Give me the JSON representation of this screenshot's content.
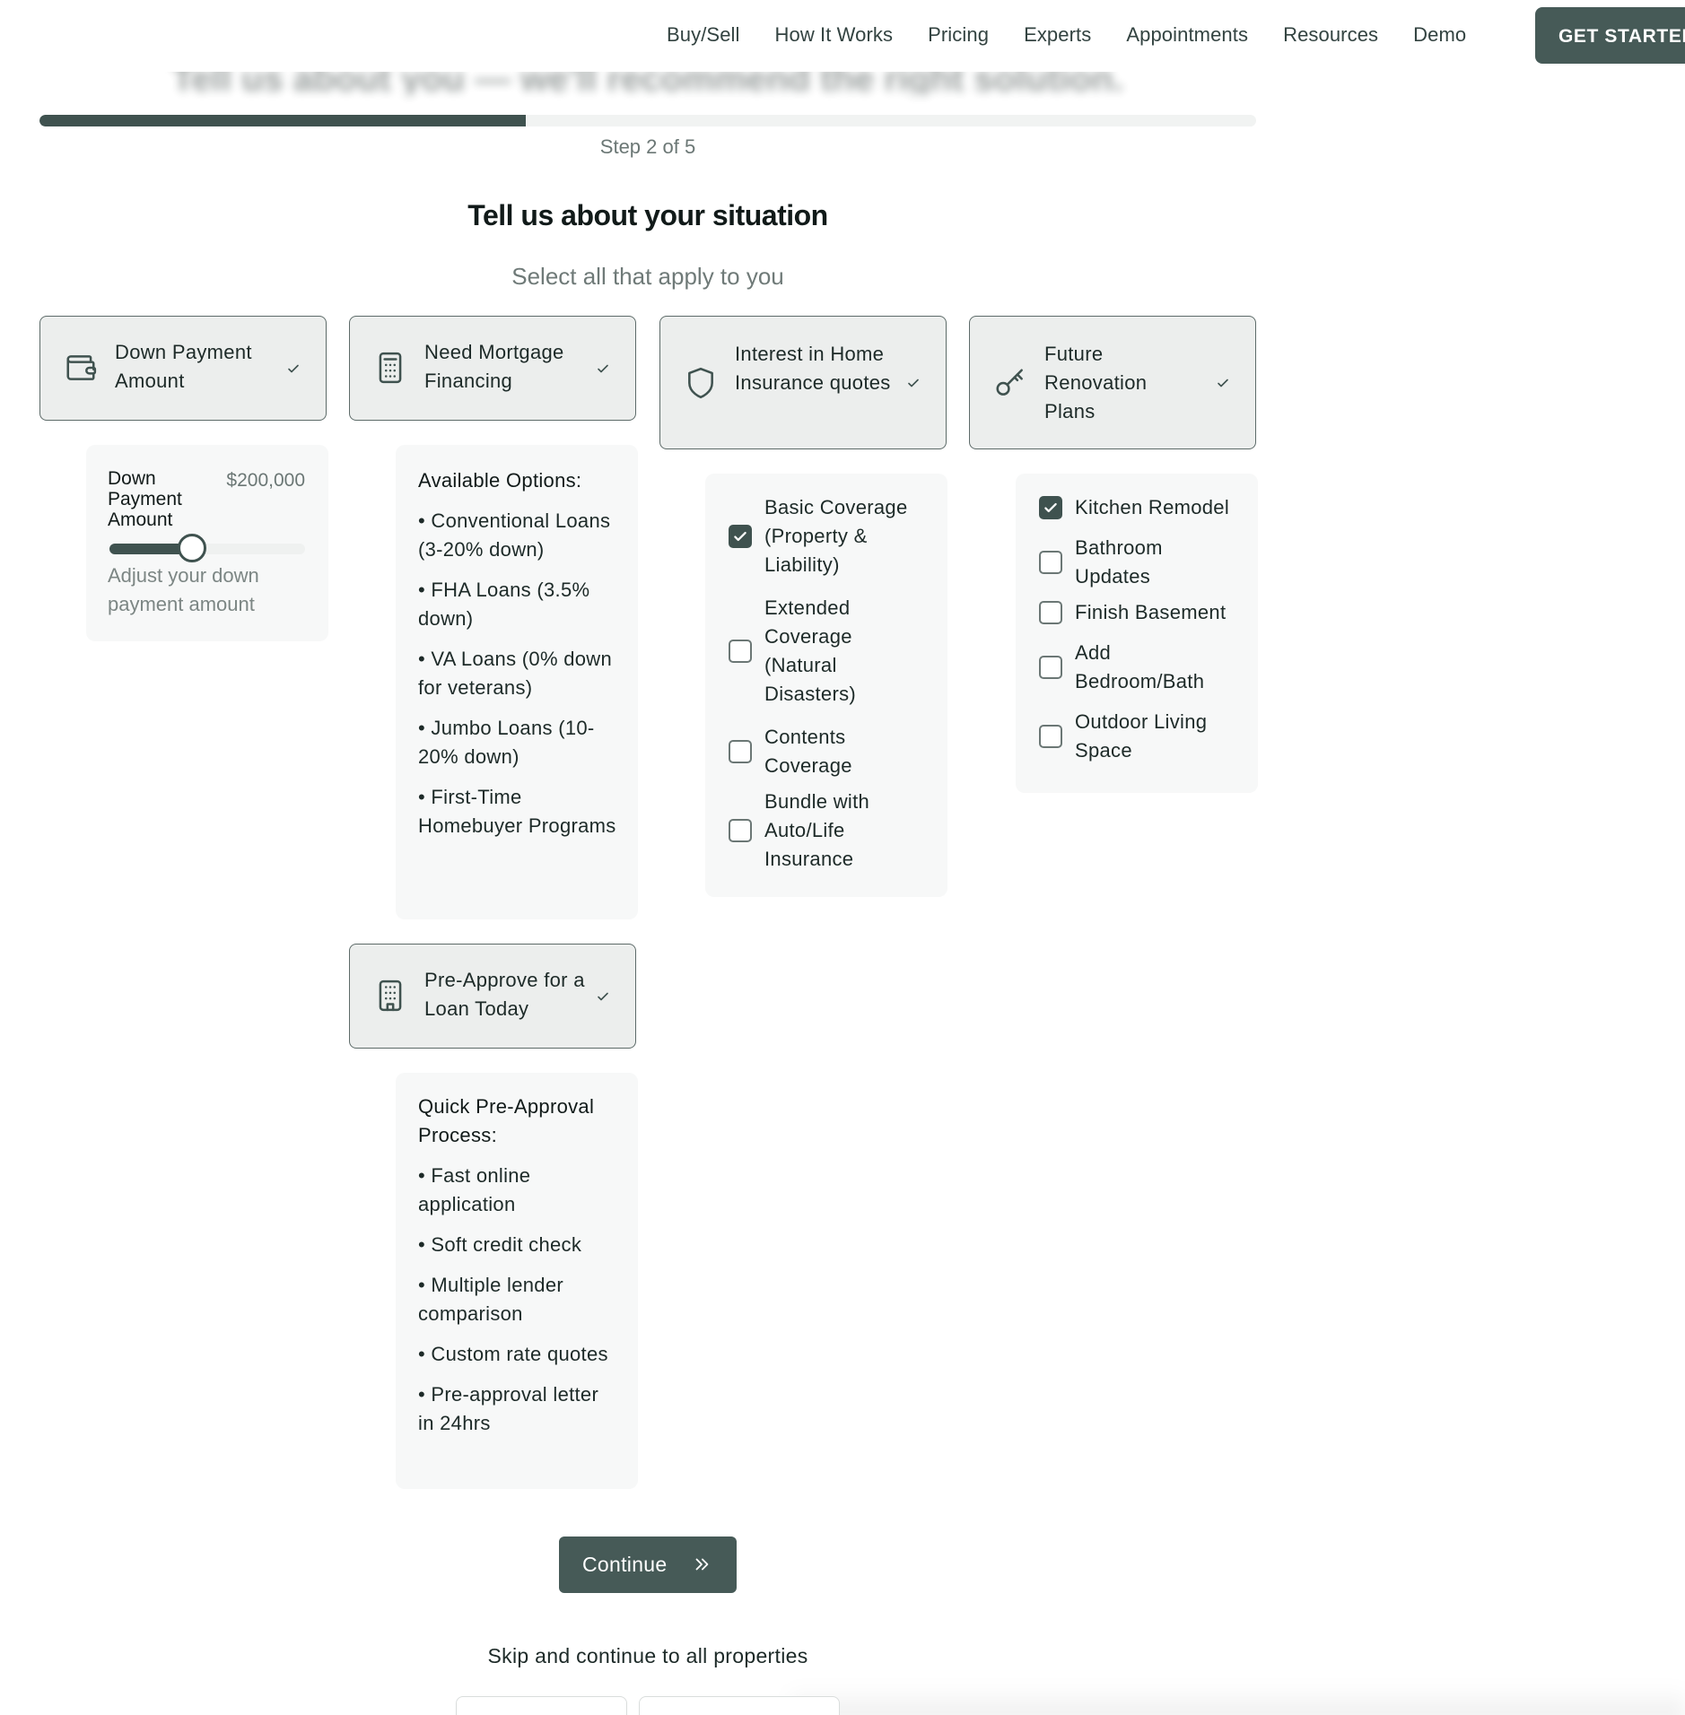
{
  "nav": {
    "links": [
      "Buy/Sell",
      "How It Works",
      "Pricing",
      "Experts",
      "Appointments",
      "Resources",
      "Demo"
    ],
    "cta": "GET STARTED"
  },
  "ghost_heading": "Tell us about you — we'll recommend the right solution.",
  "progress": {
    "step_text": "Step 2 of 5",
    "fraction": 0.4
  },
  "title": "Tell us about your situation",
  "subtitle": "Select all that apply to you",
  "cards": {
    "down_payment": {
      "label": "Down Payment Amount",
      "panel": {
        "label": "Down Payment Amount",
        "value": "$200,000",
        "slider_fraction": 0.42,
        "hint": "Adjust your down payment amount"
      }
    },
    "mortgage": {
      "label": "Need Mortgage Financing",
      "panel_heading": "Available Options:",
      "items": [
        "• Conventional Loans (3-20% down)",
        "• FHA Loans (3.5% down)",
        "• VA Loans (0% down for veterans)",
        "• Jumbo Loans (10-20% down)",
        "• First-Time Homebuyer Programs"
      ]
    },
    "insurance": {
      "label": "Interest in Home Insurance quotes",
      "options": [
        {
          "label": "Basic Coverage (Property & Liability)",
          "checked": true
        },
        {
          "label": "Extended Coverage (Natural Disasters)",
          "checked": false
        },
        {
          "label": "Contents Coverage",
          "checked": false
        },
        {
          "label": "Bundle with Auto/Life Insurance",
          "checked": false
        }
      ]
    },
    "renovation": {
      "label": "Future Renovation Plans",
      "options": [
        {
          "label": "Kitchen Remodel",
          "checked": true
        },
        {
          "label": "Bathroom Updates",
          "checked": false
        },
        {
          "label": "Finish Basement",
          "checked": false
        },
        {
          "label": "Add Bedroom/Bath",
          "checked": false
        },
        {
          "label": "Outdoor Living Space",
          "checked": false
        }
      ]
    },
    "preapprove": {
      "label": "Pre-Approve for a Loan Today",
      "panel_heading": "Quick Pre-Approval Process:",
      "items": [
        "• Fast online application",
        "• Soft credit check",
        "• Multiple lender comparison",
        "• Custom rate quotes",
        "• Pre-approval letter in 24hrs"
      ]
    }
  },
  "continue_label": "Continue",
  "skip_label": "Skip and continue to all properties",
  "colors": {
    "accent": "#3f524f",
    "card_bg": "#eceeed",
    "panel_bg": "#f7f8f8"
  },
  "icons": {
    "down_payment": "wallet-icon",
    "mortgage": "calculator-icon",
    "insurance": "shield-icon",
    "renovation": "key-icon",
    "preapprove": "building-icon",
    "continue": "chevrons-right-icon"
  }
}
